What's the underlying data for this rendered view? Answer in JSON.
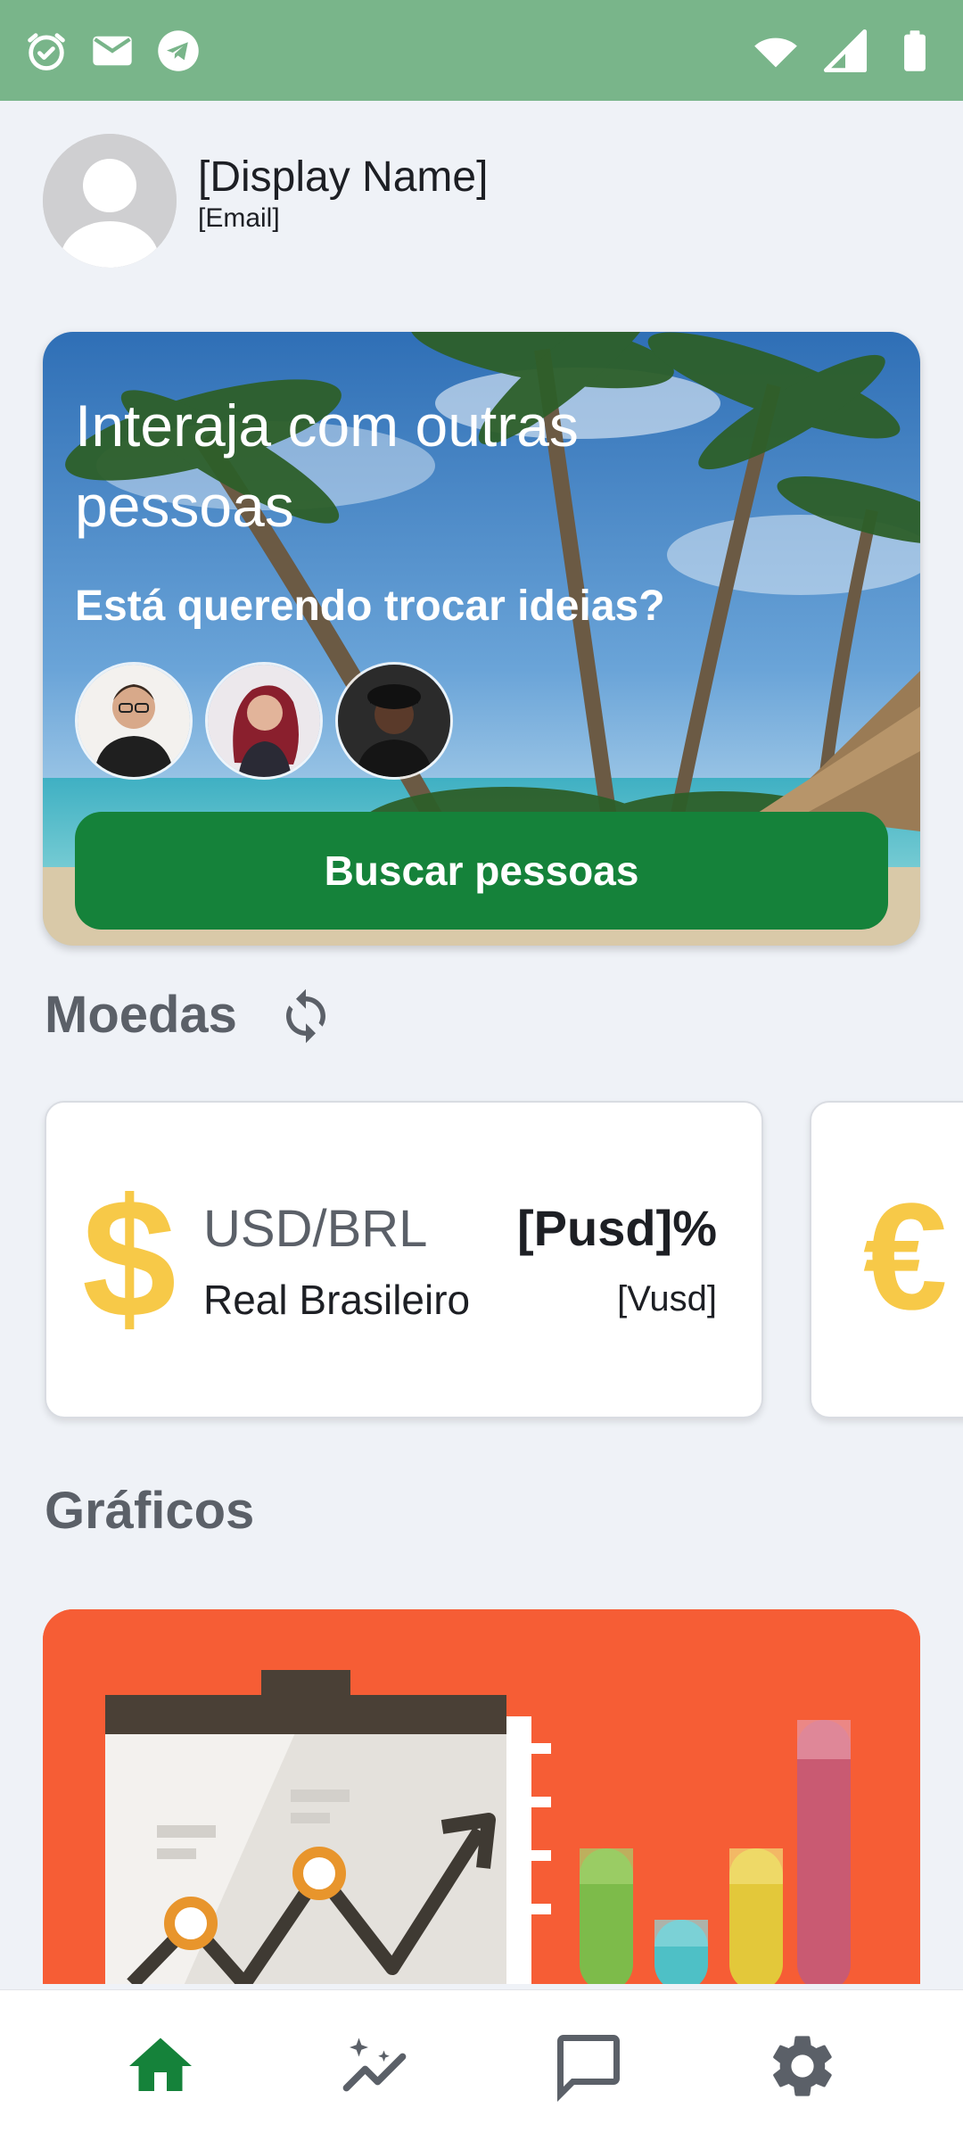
{
  "profile": {
    "display_name": "[Display Name]",
    "email": "[Email]"
  },
  "hero": {
    "title": "Interaja com outras pessoas",
    "subtitle": "Está querendo trocar ideias?",
    "button_label": "Buscar pessoas"
  },
  "sections": {
    "currencies_title": "Moedas",
    "charts_title": "Gráficos"
  },
  "currencies": [
    {
      "symbol": "$",
      "pair": "USD/BRL",
      "name": "Real Brasileiro",
      "percent": "[Pusd]%",
      "value": "[Vusd]"
    },
    {
      "symbol": "€"
    }
  ],
  "icons": {
    "status_left": [
      "alarm-icon",
      "mail-icon",
      "telegram-icon"
    ],
    "status_right": [
      "wifi-icon",
      "signal-icon",
      "battery-icon"
    ],
    "refresh": "refresh-icon",
    "nav": [
      "home-icon",
      "sparkle-chart-icon",
      "chat-icon",
      "settings-icon"
    ]
  },
  "colors": {
    "status_bar": "#79b58a",
    "primary_green": "#15823a",
    "accent_yellow": "#f7c948",
    "charts_bg": "#f65d35",
    "nav_inactive": "#5b6068"
  }
}
